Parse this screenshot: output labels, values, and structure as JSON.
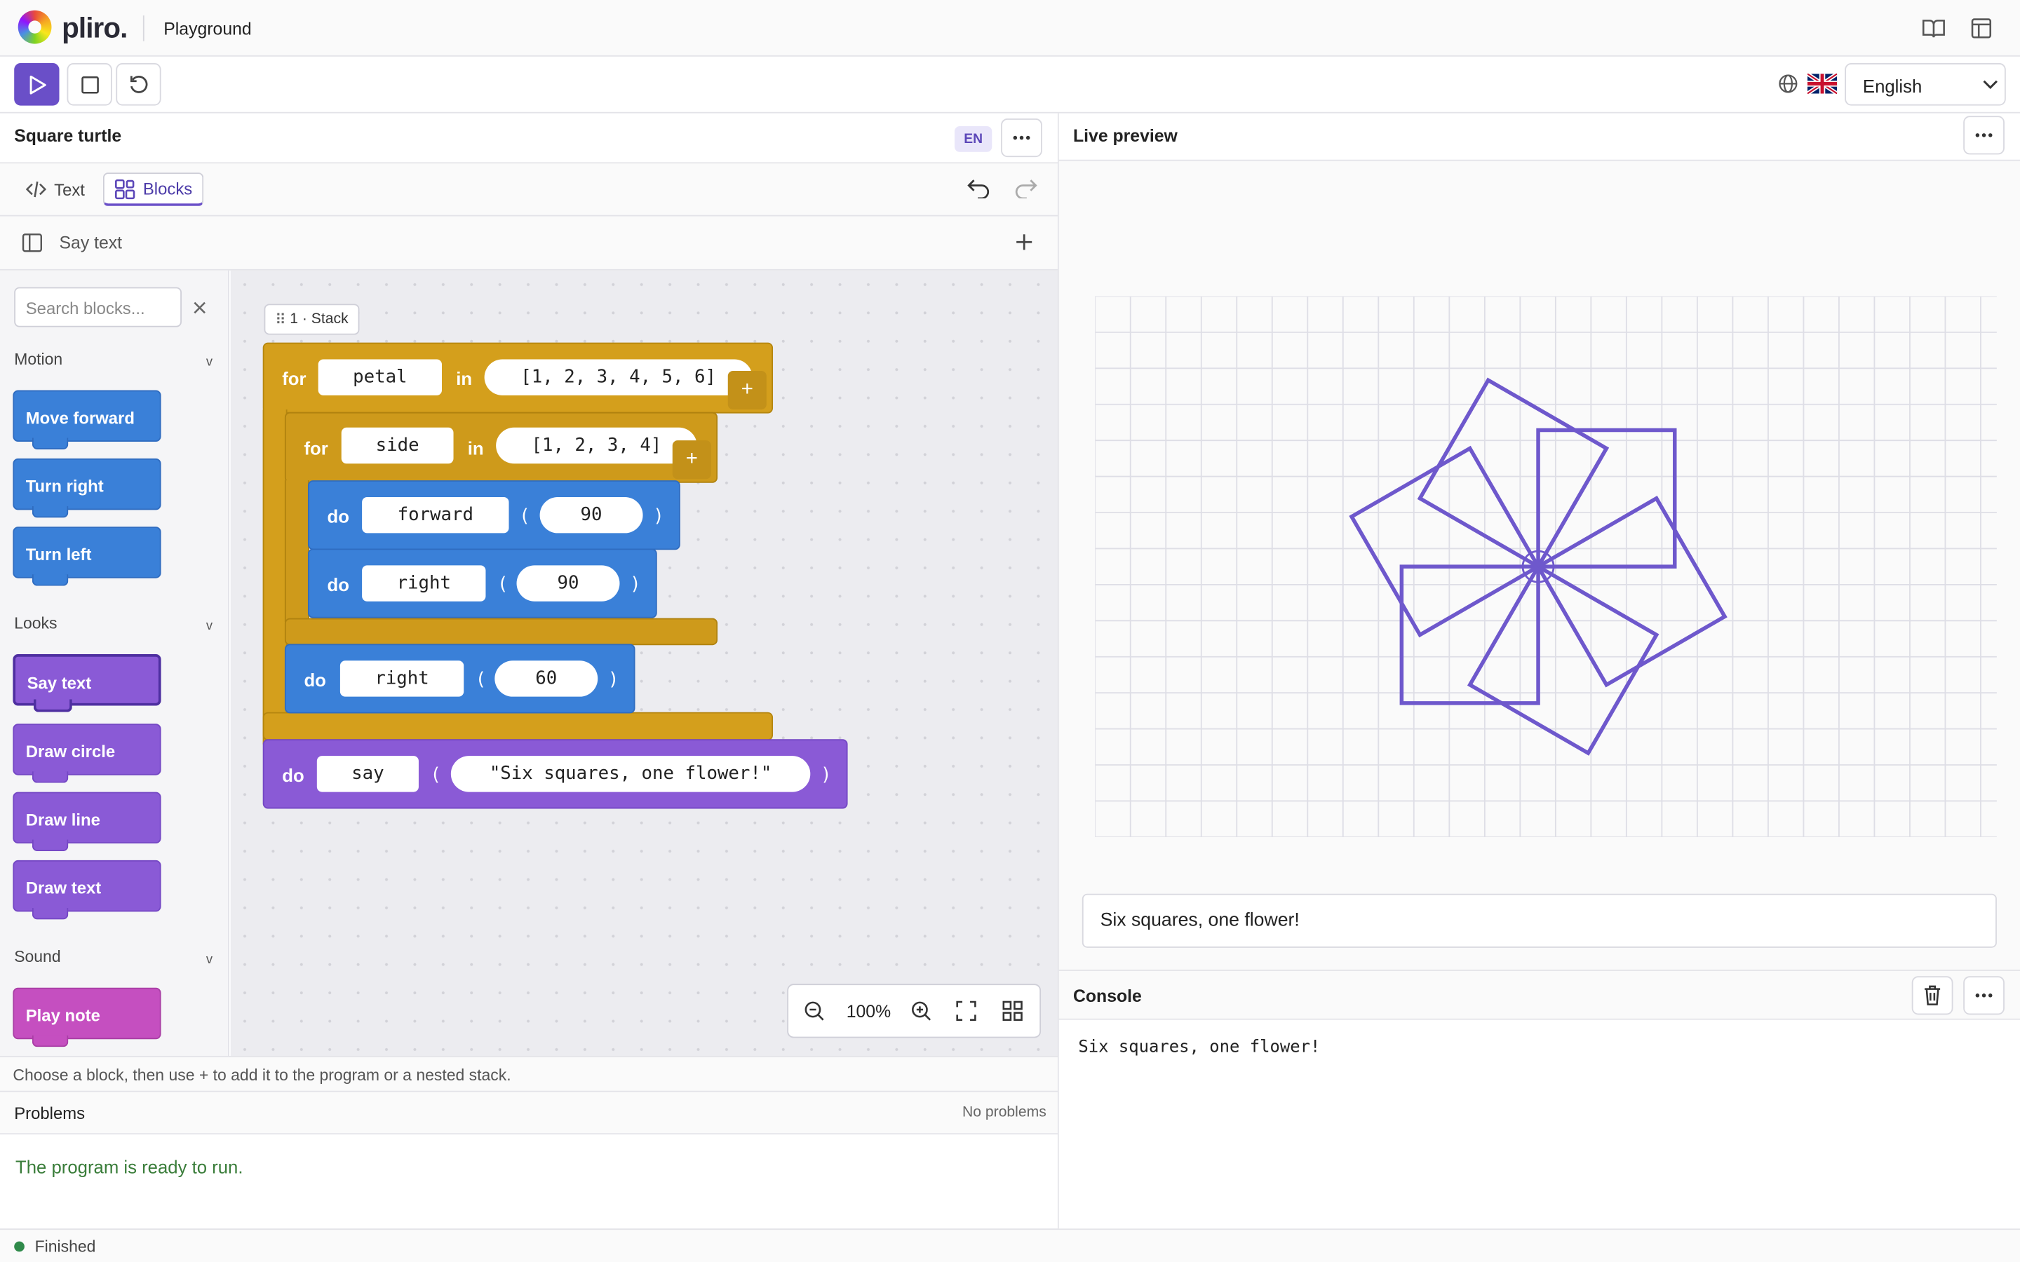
{
  "app": {
    "brand": "pliro.",
    "breadcrumb": "Playground"
  },
  "toolbar": {
    "language_selected": "English"
  },
  "editor": {
    "program_title": "Square turtle",
    "lang_badge": "EN",
    "tabs": [
      {
        "label": "Text"
      },
      {
        "label": "Blocks",
        "active": true
      }
    ],
    "selected_block": "Say text"
  },
  "palette": {
    "search_placeholder": "Search blocks...",
    "categories": [
      {
        "name": "Motion",
        "blocks": [
          "Move forward",
          "Turn right",
          "Turn left"
        ]
      },
      {
        "name": "Looks",
        "blocks": [
          "Say text",
          "Draw circle",
          "Draw line",
          "Draw text"
        ]
      },
      {
        "name": "Sound",
        "blocks": [
          "Play note"
        ]
      }
    ]
  },
  "workspace": {
    "stack_label": "1 · Stack",
    "blocks": {
      "for_kw": "for",
      "in_kw": "in",
      "do_kw": "do",
      "open_paren": "(",
      "close_paren": ")",
      "outer_var": "petal",
      "outer_list": "[1, 2, 3, 4, 5, 6]",
      "inner_var": "side",
      "inner_list": "[1, 2, 3, 4]",
      "forward_fn": "forward",
      "forward_arg": "90",
      "right_fn": "right",
      "right_arg": "90",
      "right2_fn": "right",
      "right2_arg": "60",
      "say_fn": "say",
      "say_arg": "\"Six squares, one flower!\""
    },
    "zoom_level": "100%"
  },
  "hint_text": "Choose a block, then use + to add it to the program or a nested stack.",
  "problems": {
    "title": "Problems",
    "summary": "No problems",
    "message": "The program is ready to run."
  },
  "status": {
    "text": "Finished"
  },
  "preview": {
    "title": "Live preview",
    "speech": "Six squares, one flower!"
  },
  "console": {
    "title": "Console",
    "output": "Six squares, one flower!"
  },
  "colors": {
    "accent": "#6a4fc8",
    "loop": "#d49f1c",
    "motion": "#3a80d8",
    "looks": "#8a5ad6",
    "sound": "#c54fc0",
    "drawing": "#6e58cc",
    "ready": "#3a7d3a"
  }
}
